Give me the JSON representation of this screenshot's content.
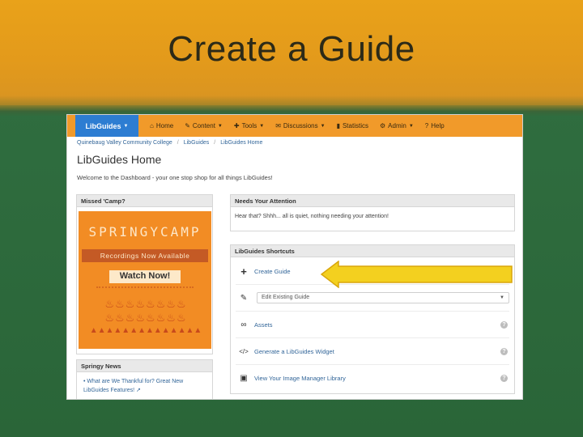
{
  "slide": {
    "title": "Create a Guide"
  },
  "navbar": {
    "brand": "LibGuides",
    "items": [
      {
        "icon": "home-icon",
        "label": "Home",
        "caret": false
      },
      {
        "icon": "content-icon",
        "label": "Content",
        "caret": true
      },
      {
        "icon": "wrench-icon",
        "label": "Tools",
        "caret": true
      },
      {
        "icon": "discussions-icon",
        "label": "Discussions",
        "caret": true
      },
      {
        "icon": "statistics-icon",
        "label": "Statistics",
        "caret": false
      },
      {
        "icon": "admin-icon",
        "label": "Admin",
        "caret": true
      },
      {
        "icon": "help-icon",
        "label": "Help",
        "caret": false
      }
    ]
  },
  "breadcrumb": [
    "Quinebaug Valley Community College",
    "LibGuides",
    "LibGuides Home"
  ],
  "page": {
    "title": "LibGuides Home",
    "welcome": "Welcome to the Dashboard - your one stop shop for all things LibGuides!"
  },
  "panels": {
    "missed": {
      "title": "Missed 'Camp?",
      "promo_title": "SPRINGYCAMP",
      "promo_ribbon": "Recordings Now Available",
      "promo_button": "Watch Now!"
    },
    "news": {
      "title": "Springy News",
      "link_line1": "What are We Thankful for? Great New",
      "link_line2": "LibGuides Features!"
    },
    "attention": {
      "title": "Needs Your Attention",
      "text": "Hear that? Shhh... all is quiet, nothing needing your attention!"
    },
    "shortcuts": {
      "title": "LibGuides Shortcuts",
      "create": "Create Guide",
      "edit_placeholder": "Edit Existing Guide",
      "assets": "Assets",
      "widget": "Generate a LibGuides Widget",
      "image_manager": "View Your Image Manager Library"
    }
  },
  "colors": {
    "navbar": "#f19a2a",
    "brand": "#2d7dd2",
    "arrow": "#f3d01f",
    "link": "#336699"
  }
}
